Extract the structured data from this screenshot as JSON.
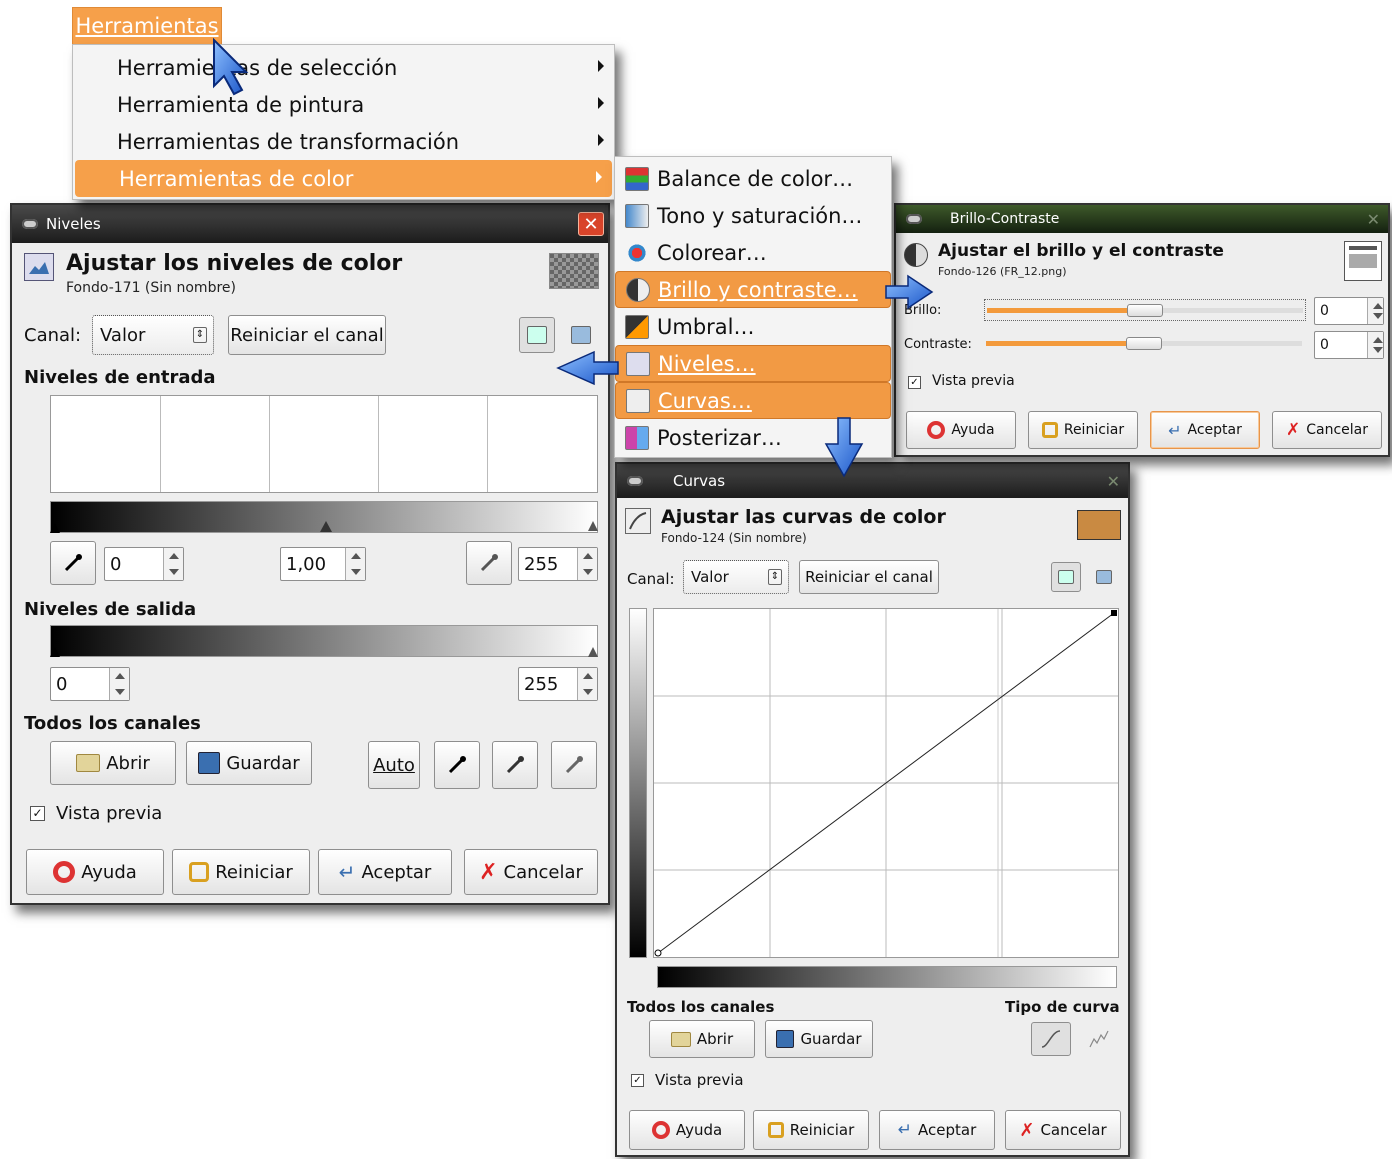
{
  "menu": {
    "title": "Herramientas",
    "items": [
      {
        "label": "Herramientas de selección",
        "submenu": true
      },
      {
        "label": "Herramienta de pintura",
        "submenu": true
      },
      {
        "label": "Herramientas de transformación",
        "submenu": true
      },
      {
        "label": "Herramientas de color",
        "submenu": true
      }
    ]
  },
  "color_submenu": {
    "items": [
      {
        "label": "Balance de color…"
      },
      {
        "label": "Tono y saturación…"
      },
      {
        "label": "Colorear…"
      },
      {
        "label": "Brillo y contraste…"
      },
      {
        "label": "Umbral…"
      },
      {
        "label": "Niveles…"
      },
      {
        "label": "Curvas…"
      },
      {
        "label": "Posterizar…"
      }
    ]
  },
  "levels": {
    "window_title": "Niveles",
    "heading": "Ajustar los niveles de color",
    "subheading": "Fondo-171 (Sin nombre)",
    "channel_label": "Canal:",
    "channel_value": "Valor",
    "reset_channel": "Reiniciar el canal",
    "input_levels": "Niveles de entrada",
    "input_low": "0",
    "input_gamma": "1,00",
    "input_high": "255",
    "output_levels": "Niveles de salida",
    "output_low": "0",
    "output_high": "255",
    "all_channels": "Todos los canales",
    "open": "Abrir",
    "save": "Guardar",
    "auto": "Auto",
    "preview": "Vista previa",
    "help": "Ayuda",
    "reset": "Reiniciar",
    "accept": "Aceptar",
    "cancel": "Cancelar"
  },
  "brightness": {
    "window_title": "Brillo-Contraste",
    "heading": "Ajustar el brillo y el contraste",
    "subheading": "Fondo-126 (FR_12.png)",
    "brightness_label": "Brillo:",
    "brightness_value": "0",
    "contrast_label": "Contraste:",
    "contrast_value": "0",
    "preview": "Vista previa",
    "help": "Ayuda",
    "reset": "Reiniciar",
    "accept": "Aceptar",
    "cancel": "Cancelar"
  },
  "curves": {
    "window_title": "Curvas",
    "heading": "Ajustar las curvas de color",
    "subheading": "Fondo-124 (Sin nombre)",
    "channel_label": "Canal:",
    "channel_value": "Valor",
    "reset_channel": "Reiniciar el canal",
    "all_channels": "Todos los canales",
    "curve_type": "Tipo de curva",
    "open": "Abrir",
    "save": "Guardar",
    "preview": "Vista previa",
    "help": "Ayuda",
    "reset": "Reiniciar",
    "accept": "Aceptar",
    "cancel": "Cancelar",
    "swatch_color": "#c98a42"
  },
  "colors": {
    "accent": "#f6a04a",
    "arrow": "#2a6ad8"
  }
}
